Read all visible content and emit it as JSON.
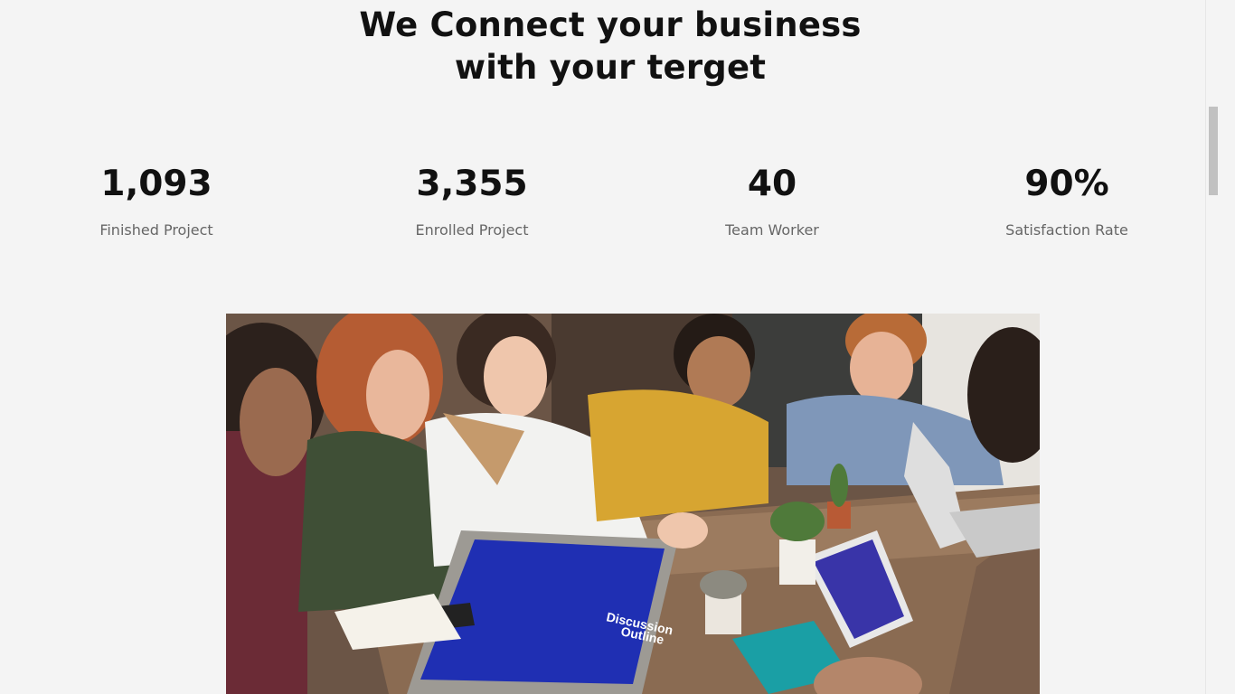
{
  "section": {
    "heading_line1": "We Connect your business",
    "heading_line2": "with your terget"
  },
  "stats": [
    {
      "value": "1,093",
      "label": "Finished Project"
    },
    {
      "value": "3,355",
      "label": "Enrolled Project"
    },
    {
      "value": "40",
      "label": "Team Worker"
    },
    {
      "value": "90%",
      "label": "Satisfaction Rate"
    }
  ],
  "photo": {
    "screen_text_title": "Discussion",
    "screen_text_sub": "Outline"
  },
  "colors": {
    "background": "#f4f4f4",
    "heading": "#111111",
    "label": "#666666"
  }
}
